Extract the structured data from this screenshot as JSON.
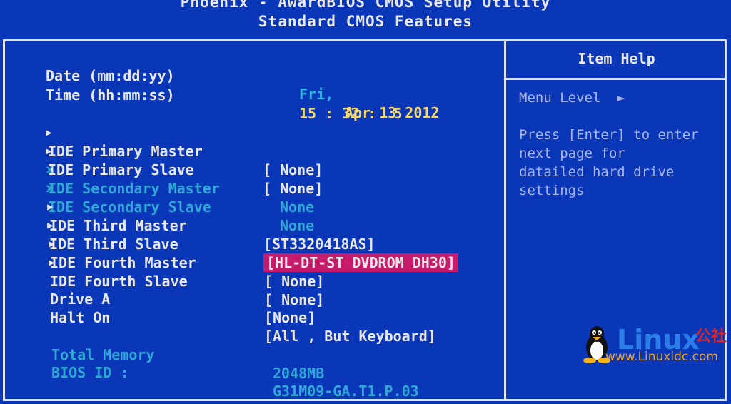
{
  "header": {
    "line1": "Phoenix - AwardBIOS CMOS Setup Utility",
    "line2": "Standard CMOS Features"
  },
  "datetime": {
    "date_label": "Date (mm:dd:yy)",
    "time_label": "Time (hh:mm:ss)",
    "weekday": "Fri,",
    "date": "Apr 13 2012",
    "time": "15 : 32 :  5"
  },
  "ide": [
    {
      "label": "IDE Primary Master",
      "value": "[ None]",
      "enabled": true
    },
    {
      "label": "IDE Primary Slave",
      "value": "[ None]",
      "enabled": true
    },
    {
      "label": "IDE Secondary Master",
      "value": "None",
      "enabled": false
    },
    {
      "label": "IDE Secondary Slave",
      "value": "None",
      "enabled": false
    },
    {
      "label": "IDE Third Master",
      "value": "[ST3320418AS]",
      "enabled": true
    },
    {
      "label": "IDE Third Slave",
      "value": "[HL-DT-ST DVDROM DH30]",
      "enabled": true,
      "selected": true
    },
    {
      "label": "IDE Fourth Master",
      "value": "[ None]",
      "enabled": true
    },
    {
      "label": "IDE Fourth Slave",
      "value": "[ None]",
      "enabled": true
    }
  ],
  "drive_a": {
    "label": "Drive A",
    "value": "[None]"
  },
  "halt_on": {
    "label": "Halt On",
    "value": "[All , But Keyboard]"
  },
  "memory": {
    "label": "Total Memory",
    "value": "2048MB"
  },
  "bios_id": {
    "label": "BIOS ID :",
    "value": "G31M09-GA.T1.P.03"
  },
  "help": {
    "title": "Item Help",
    "menu_level": "Menu Level  ►",
    "lines": [
      "Press [Enter] to enter",
      "next page for",
      "datailed hard drive",
      "settings"
    ]
  },
  "markers": {
    "submenu": "▶",
    "disabled": "x"
  },
  "watermark": {
    "brand": "Linux",
    "cn": "公社",
    "url": "www.Linuxidc.com"
  },
  "colors": {
    "background": "#0a36b8",
    "text": "#e8e8e8",
    "value_highlight": "#f4d86a",
    "disabled": "#2fa8d6",
    "selection": "#c81a6a"
  }
}
